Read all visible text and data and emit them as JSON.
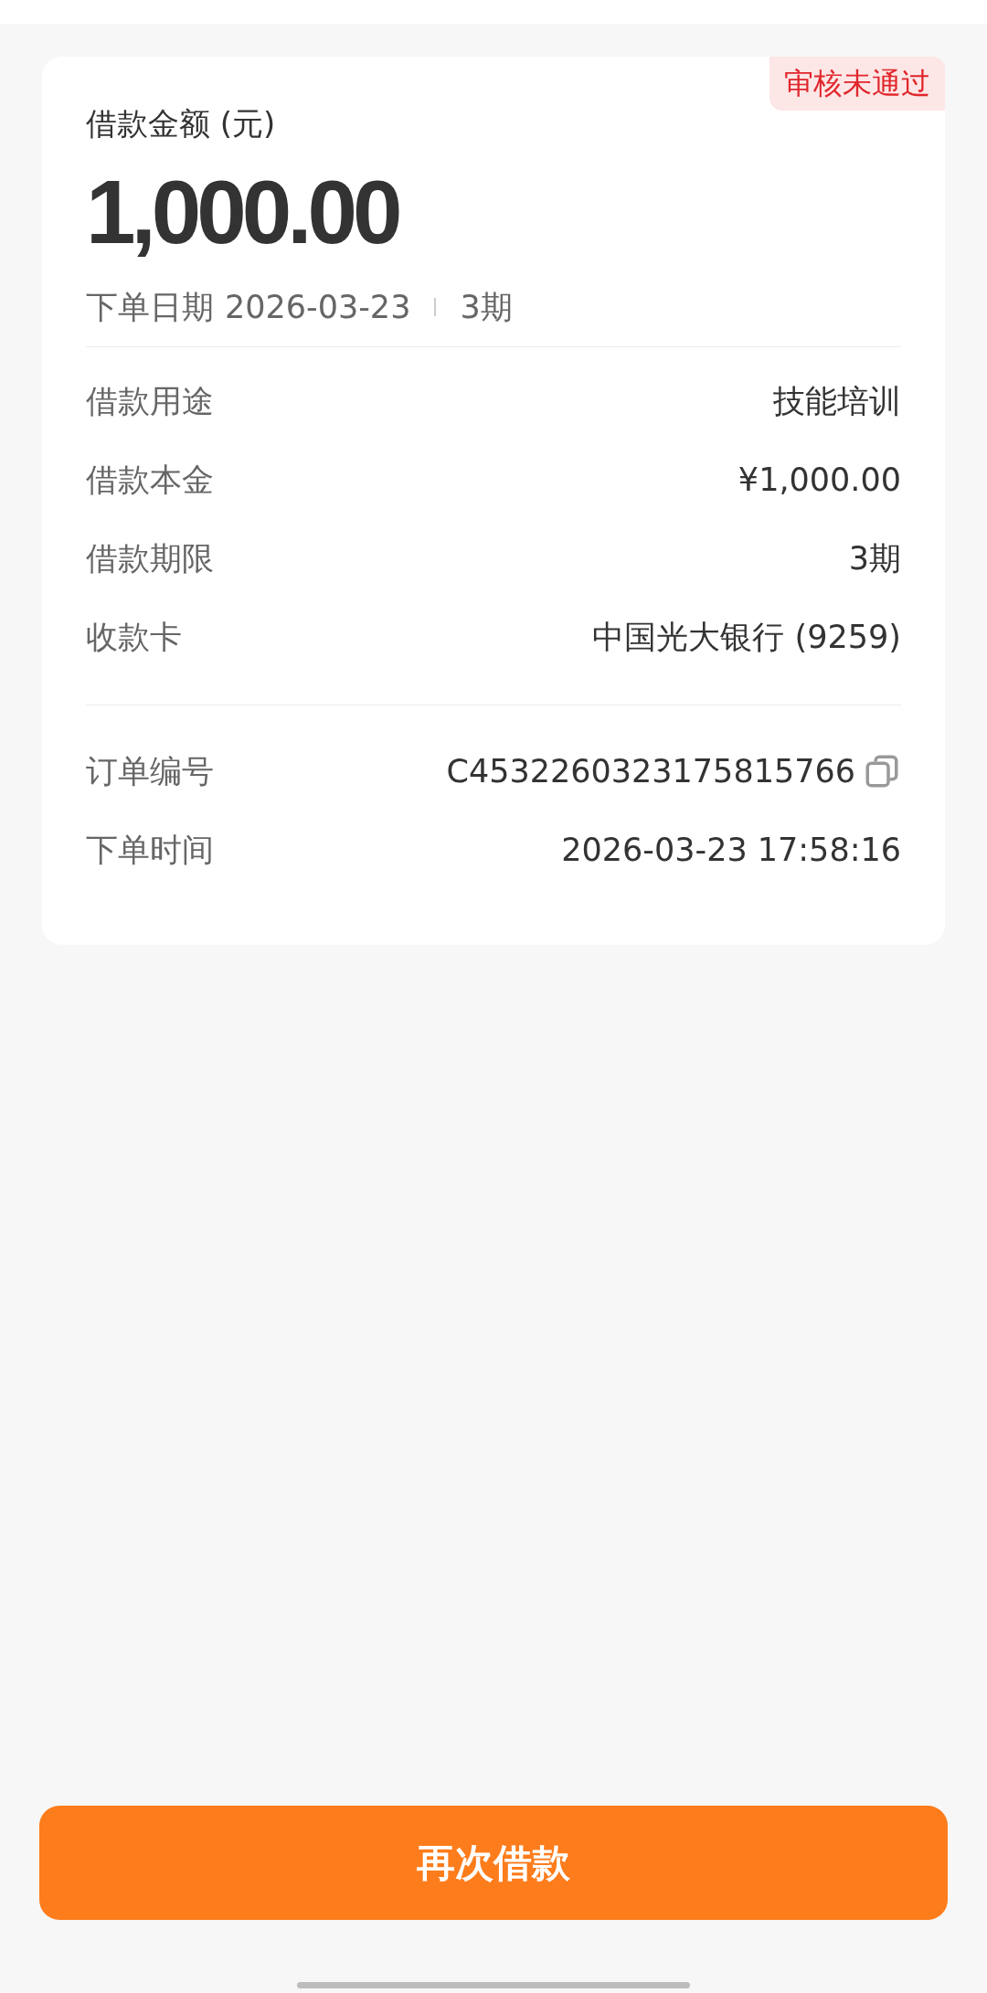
{
  "card": {
    "status_badge": "审核未通过",
    "amount_label": "借款金额 (元)",
    "amount": "1,000.00",
    "order_date_label": "下单日期",
    "order_date": "2026-03-23",
    "term": "3期",
    "details": [
      {
        "label": "借款用途",
        "value": "技能培训"
      },
      {
        "label": "借款本金",
        "value": "¥1,000.00"
      },
      {
        "label": "借款期限",
        "value": "3期"
      },
      {
        "label": "收款卡",
        "value": "中国光大银行 (9259)"
      }
    ],
    "order_info": [
      {
        "label": "订单编号",
        "value": "C4532260323175815766",
        "copyable": true
      },
      {
        "label": "下单时间",
        "value": "2026-03-23 17:58:16",
        "copyable": false
      }
    ]
  },
  "primary_button": "再次借款"
}
